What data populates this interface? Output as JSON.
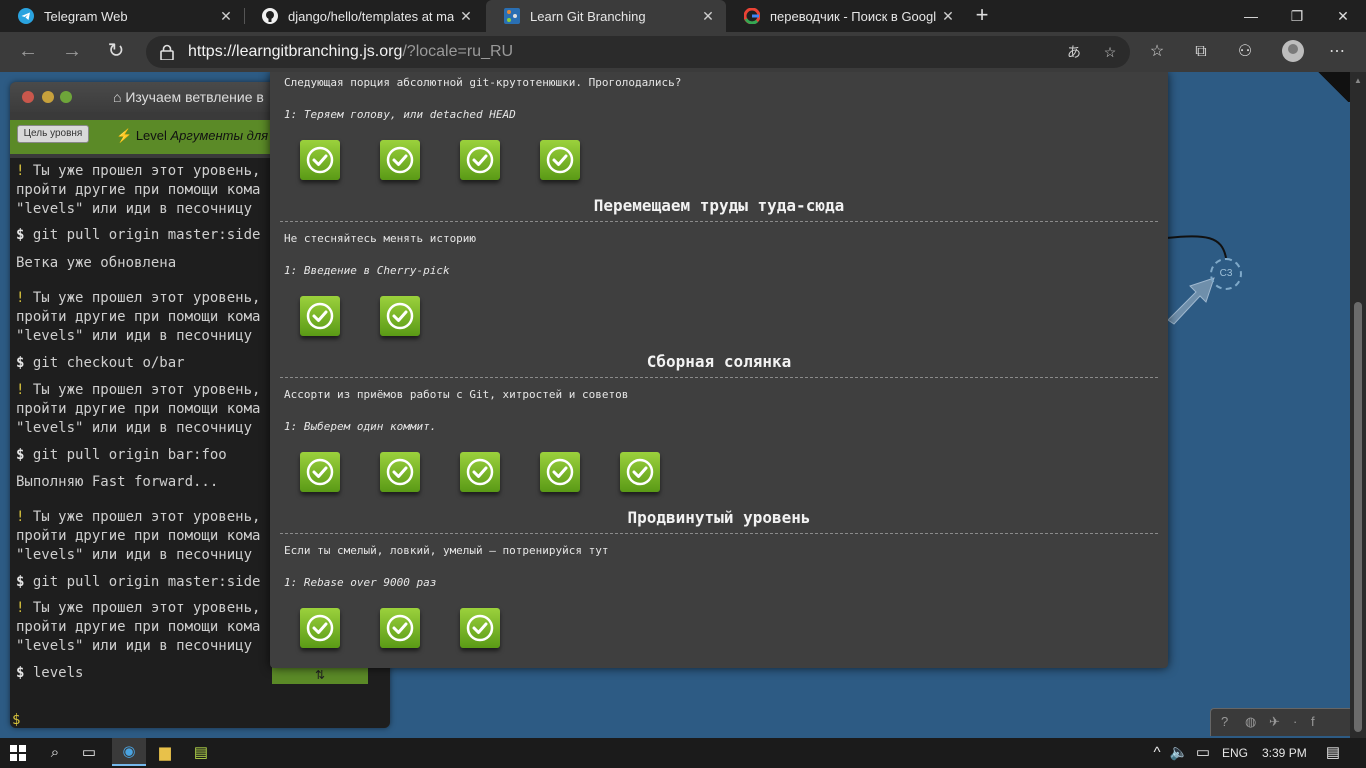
{
  "browser": {
    "tabs": [
      {
        "title": "Telegram Web",
        "icon": "telegram-icon",
        "active": false
      },
      {
        "title": "django/hello/templates at main",
        "icon": "github-icon",
        "active": false
      },
      {
        "title": "Learn Git Branching",
        "icon": "git-branching-icon",
        "active": true
      },
      {
        "title": "переводчик - Поиск в Google",
        "icon": "google-icon",
        "active": false
      }
    ],
    "new_tab": "+",
    "url_host": "https://learngitbranching.js.org",
    "url_path": "/?locale=ru_RU",
    "controls": {
      "minimize": "—",
      "maximize": "❐",
      "close": "✕"
    }
  },
  "terminal": {
    "title": "Изучаем ветвление в",
    "goal_button": "Цель уровня",
    "level_prefix": "Level",
    "level_name": "Аргументы для р",
    "level_button": "⇅",
    "lines": [
      {
        "kind": "warn",
        "text": "Ты уже прошел этот уровень,"
      },
      {
        "kind": "text",
        "text": "пройти другие при помощи кома"
      },
      {
        "kind": "text",
        "text": "\"levels\" или иди в песочницу"
      },
      {
        "kind": "cmd",
        "text": "git pull origin master:side"
      },
      {
        "kind": "text",
        "text": "Ветка уже обновлена"
      },
      {
        "kind": "warn",
        "text": "Ты уже прошел этот уровень,"
      },
      {
        "kind": "text",
        "text": "пройти другие при помощи кома"
      },
      {
        "kind": "text",
        "text": "\"levels\" или иди в песочницу"
      },
      {
        "kind": "cmd",
        "text": "git checkout o/bar"
      },
      {
        "kind": "warn",
        "text": "Ты уже прошел этот уровень,"
      },
      {
        "kind": "text",
        "text": "пройти другие при помощи кома"
      },
      {
        "kind": "text",
        "text": "\"levels\" или иди в песочницу"
      },
      {
        "kind": "cmd",
        "text": "git pull origin bar:foo"
      },
      {
        "kind": "text",
        "text": "Выполняю Fast forward..."
      },
      {
        "kind": "warn",
        "text": "Ты уже прошел этот уровень,"
      },
      {
        "kind": "text",
        "text": "пройти другие при помощи кома"
      },
      {
        "kind": "text",
        "text": "\"levels\" или иди в песочницу"
      },
      {
        "kind": "cmd",
        "text": "git pull origin master:side"
      },
      {
        "kind": "warn",
        "text": "Ты уже прошел этот уровень,"
      },
      {
        "kind": "text",
        "text": "пройти другие при помощи кома"
      },
      {
        "kind": "text",
        "text": "\"levels\" или иди в песочницу"
      },
      {
        "kind": "cmd",
        "text": "levels"
      }
    ],
    "prompt_symbol": "$",
    "warn_symbol": "!"
  },
  "visualization": {
    "commit_label": "C3"
  },
  "dialog": {
    "sections": [
      {
        "title": "",
        "about": "Следующая порция абсолютной git-крутотенюшки. Проголодались?",
        "sequence": "1: Теряем голову, или detached HEAD",
        "levels": 4
      },
      {
        "title": "Перемещаем труды туда-сюда",
        "about": "Не стесняйтесь менять историю",
        "sequence": "1: Введение в Cherry-pick",
        "levels": 2
      },
      {
        "title": "Сборная солянка",
        "about": "Ассорти из приёмов работы с Git, хитростей и советов",
        "sequence": "1: Выберем один коммит.",
        "levels": 5
      },
      {
        "title": "Продвинутый уровень",
        "about": "Если ты смелый, ловкий, умелый – потренируйся тут",
        "sequence": "1: Rebase over 9000 раз",
        "levels": 3
      }
    ]
  },
  "taskbar": {
    "language": "ENG",
    "time": "3:39 PM"
  }
}
